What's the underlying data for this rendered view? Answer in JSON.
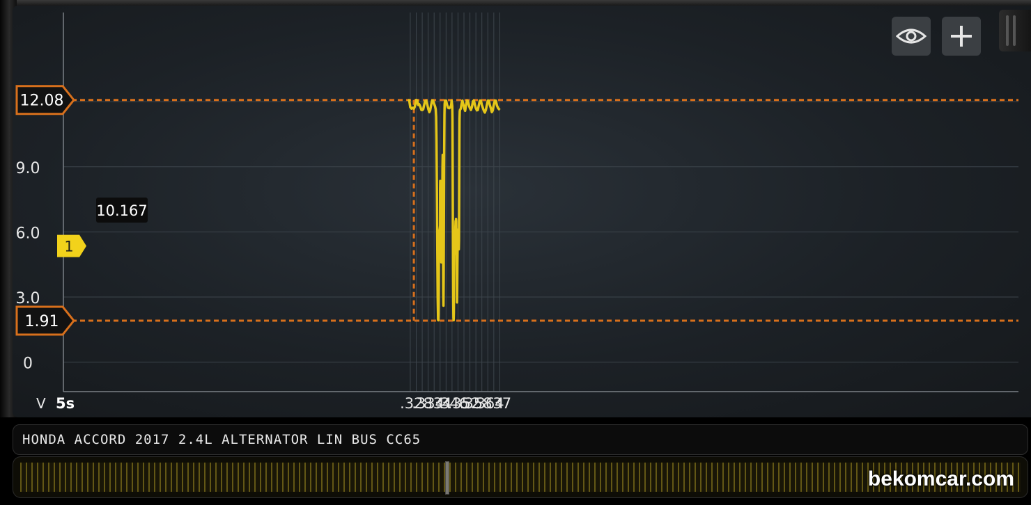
{
  "app": {
    "vehicle_title": "HONDA ACCORD 2017 2.4L ALTERNATOR LIN BUS CC65",
    "watermark": "bekomcar.com"
  },
  "toolbar": {
    "visibility_icon": "eye-icon",
    "add_icon": "plus-icon"
  },
  "colors": {
    "trace": "#e5c619",
    "cursor": "#d8701c",
    "channel_marker": "#f2d21b"
  },
  "chart_data": {
    "type": "line",
    "ylabel": "V",
    "x_time_base": "5s",
    "y_ticks": [
      "0",
      "3.0",
      "6.0",
      "9.0"
    ],
    "x_ticks": [
      ".328",
      ".334",
      ".34",
      ".346",
      ".352",
      ".358",
      ".364",
      ".37"
    ],
    "x_tick_values": [
      0.328,
      0.334,
      0.34,
      0.346,
      0.352,
      0.358,
      0.364,
      0.37
    ],
    "xlim": [
      0.3239,
      0.37
    ],
    "ylim": [
      -0.7,
      15.5
    ],
    "grid": true,
    "cursor_upper_label": "12.08",
    "cursor_lower_label": "1.91",
    "cursor_upper_value": 12.08,
    "cursor_lower_value": 1.91,
    "cursor_time": 0.3268,
    "delta_label": "10.167",
    "channel_label": "1",
    "channel_offset": 5.35,
    "series": [
      {
        "points": [
          [
            0.3239,
            12.1
          ],
          [
            0.3245,
            12.05
          ],
          [
            0.325,
            11.75
          ],
          [
            0.3256,
            11.68
          ],
          [
            0.3262,
            11.72
          ],
          [
            0.3268,
            11.68
          ],
          [
            0.3272,
            11.75
          ],
          [
            0.3276,
            11.9
          ],
          [
            0.328,
            12.08
          ],
          [
            0.3285,
            12.05
          ],
          [
            0.329,
            11.85
          ],
          [
            0.3295,
            11.88
          ],
          [
            0.33,
            11.78
          ],
          [
            0.3306,
            11.62
          ],
          [
            0.3311,
            11.62
          ],
          [
            0.3315,
            11.65
          ],
          [
            0.332,
            11.85
          ],
          [
            0.3324,
            12.02
          ],
          [
            0.333,
            12.05
          ],
          [
            0.3336,
            11.85
          ],
          [
            0.3341,
            11.65
          ],
          [
            0.3346,
            11.52
          ],
          [
            0.335,
            11.6
          ],
          [
            0.3355,
            11.85
          ],
          [
            0.336,
            12.05
          ],
          [
            0.3365,
            12.05
          ],
          [
            0.337,
            11.9
          ],
          [
            0.3375,
            11.78
          ],
          [
            0.3378,
            11.65
          ],
          [
            0.338,
            11.3
          ],
          [
            0.3382,
            10.2
          ],
          [
            0.3384,
            7.8
          ],
          [
            0.3386,
            5.0
          ],
          [
            0.3388,
            3.0
          ],
          [
            0.339,
            1.95
          ],
          [
            0.3391,
            1.93
          ],
          [
            0.3392,
            2.2
          ],
          [
            0.3393,
            3.5
          ],
          [
            0.3394,
            5.6
          ],
          [
            0.3396,
            6.05
          ],
          [
            0.3398,
            6.1
          ],
          [
            0.34,
            6.3
          ],
          [
            0.34,
            8.0
          ],
          [
            0.3401,
            8.35
          ],
          [
            0.3402,
            7.5
          ],
          [
            0.3403,
            6.8
          ],
          [
            0.3404,
            6.3
          ],
          [
            0.3405,
            5.2
          ],
          [
            0.3406,
            4.6
          ],
          [
            0.3407,
            5.1
          ],
          [
            0.3408,
            5.6
          ],
          [
            0.3409,
            6.0
          ],
          [
            0.341,
            6.4
          ],
          [
            0.3411,
            7.2
          ],
          [
            0.3412,
            9.0
          ],
          [
            0.3413,
            9.55
          ],
          [
            0.3414,
            8.2
          ],
          [
            0.3415,
            5.6
          ],
          [
            0.3416,
            3.2
          ],
          [
            0.3417,
            2.6
          ],
          [
            0.3418,
            3.9
          ],
          [
            0.3419,
            6.5
          ],
          [
            0.342,
            9.0
          ],
          [
            0.3421,
            10.5
          ],
          [
            0.3422,
            11.4
          ],
          [
            0.3423,
            11.9
          ],
          [
            0.3425,
            12.05
          ],
          [
            0.343,
            12.05
          ],
          [
            0.3435,
            11.85
          ],
          [
            0.344,
            11.72
          ],
          [
            0.3446,
            11.7
          ],
          [
            0.3452,
            11.75
          ],
          [
            0.3456,
            11.85
          ],
          [
            0.3458,
            12.05
          ],
          [
            0.3461,
            11.8
          ],
          [
            0.3462,
            11.2
          ],
          [
            0.3463,
            9.8
          ],
          [
            0.3464,
            7.2
          ],
          [
            0.3465,
            4.5
          ],
          [
            0.3466,
            2.8
          ],
          [
            0.3467,
            2.05
          ],
          [
            0.3468,
            1.93
          ],
          [
            0.3469,
            2.3
          ],
          [
            0.347,
            3.6
          ],
          [
            0.3471,
            5.1
          ],
          [
            0.3472,
            5.55
          ],
          [
            0.3473,
            5.9
          ],
          [
            0.3474,
            5.4
          ],
          [
            0.3475,
            6.05
          ],
          [
            0.3476,
            5.0
          ],
          [
            0.3477,
            6.2
          ],
          [
            0.3478,
            6.5
          ],
          [
            0.3479,
            5.6
          ],
          [
            0.348,
            6.6
          ],
          [
            0.3481,
            6.5
          ],
          [
            0.3482,
            5.6
          ],
          [
            0.3483,
            5.2
          ],
          [
            0.3484,
            4.2
          ],
          [
            0.3485,
            2.75
          ],
          [
            0.3486,
            3.3
          ],
          [
            0.3487,
            4.5
          ],
          [
            0.3488,
            5.3
          ],
          [
            0.3489,
            6.1
          ],
          [
            0.349,
            5.3
          ],
          [
            0.3491,
            5.4
          ],
          [
            0.3492,
            5.2
          ],
          [
            0.3493,
            5.3
          ],
          [
            0.3494,
            5.2
          ],
          [
            0.3495,
            5.6
          ],
          [
            0.3496,
            7.8
          ],
          [
            0.3497,
            10.3
          ],
          [
            0.3498,
            11.2
          ],
          [
            0.3499,
            11.55
          ],
          [
            0.35,
            11.62
          ],
          [
            0.3504,
            11.68
          ],
          [
            0.3508,
            11.9
          ],
          [
            0.3512,
            12.05
          ],
          [
            0.3518,
            11.85
          ],
          [
            0.3522,
            11.68
          ],
          [
            0.3526,
            11.58
          ],
          [
            0.353,
            11.82
          ],
          [
            0.3535,
            12.05
          ],
          [
            0.354,
            12.02
          ],
          [
            0.3545,
            11.82
          ],
          [
            0.355,
            11.7
          ],
          [
            0.3555,
            11.62
          ],
          [
            0.356,
            11.75
          ],
          [
            0.3565,
            12.02
          ],
          [
            0.357,
            12.05
          ],
          [
            0.3575,
            11.85
          ],
          [
            0.358,
            11.7
          ],
          [
            0.3585,
            11.6
          ],
          [
            0.359,
            11.62
          ],
          [
            0.3595,
            11.85
          ],
          [
            0.36,
            12.05
          ],
          [
            0.3605,
            12.05
          ],
          [
            0.361,
            11.85
          ],
          [
            0.3615,
            11.72
          ],
          [
            0.362,
            11.58
          ],
          [
            0.3625,
            11.5
          ],
          [
            0.363,
            11.62
          ],
          [
            0.3635,
            11.85
          ],
          [
            0.364,
            12.05
          ],
          [
            0.3645,
            12.05
          ],
          [
            0.365,
            11.85
          ],
          [
            0.3655,
            11.7
          ],
          [
            0.366,
            11.52
          ],
          [
            0.3665,
            11.6
          ],
          [
            0.367,
            11.85
          ],
          [
            0.3675,
            12.05
          ],
          [
            0.368,
            12.05
          ],
          [
            0.3686,
            11.82
          ],
          [
            0.3692,
            11.7
          ],
          [
            0.37,
            11.62
          ]
        ]
      }
    ]
  }
}
